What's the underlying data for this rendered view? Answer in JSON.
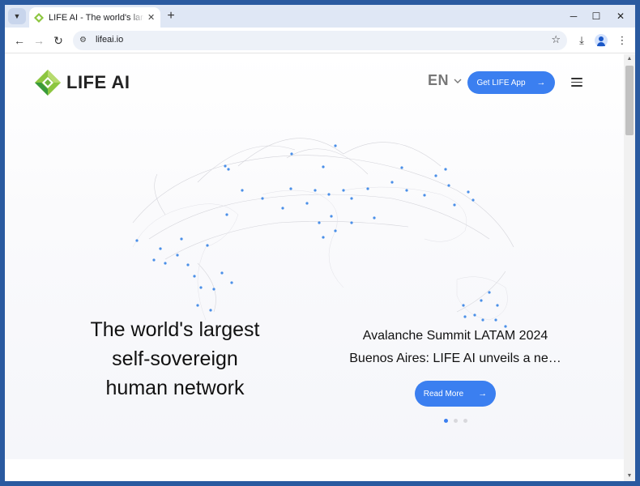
{
  "browser": {
    "tab_title": "LIFE AI - The world's largest self-sovereign human network",
    "url": "lifeai.io"
  },
  "header": {
    "logo_text": "LIFE AI",
    "language": "EN",
    "app_button_label": "Get LIFE App"
  },
  "hero": {
    "headline_lines": [
      "The world's largest",
      "self-sovereign",
      "human network"
    ]
  },
  "slide": {
    "title_lines": [
      "Avalanche Summit LATAM 2024",
      "Buenos Aires: LIFE AI unveils a ne…"
    ],
    "read_more_label": "Read More",
    "dots": [
      true,
      false,
      false
    ]
  },
  "colors": {
    "accent": "#3b7ff0",
    "logo_green": "#8cc63f",
    "logo_dark_green": "#3a9a3a",
    "map_node": "#4a8fe8"
  }
}
